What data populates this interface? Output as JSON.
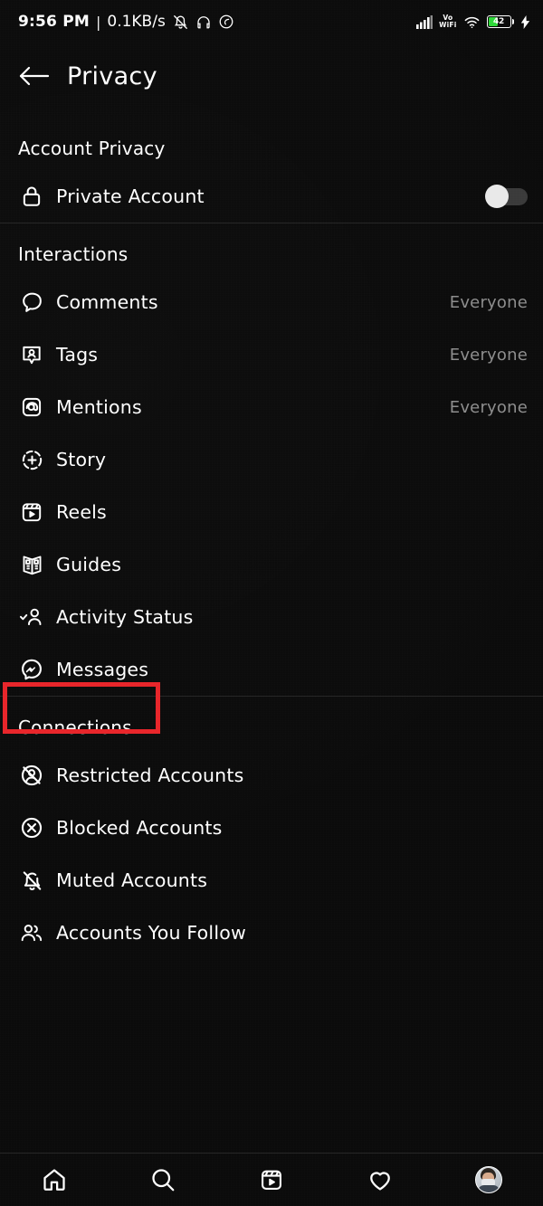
{
  "status_bar": {
    "time": "9:56 PM",
    "separator": "|",
    "network_speed": "0.1KB/s",
    "left_icons": [
      "mute-bell-icon",
      "headphones-icon",
      "dnd-icon"
    ],
    "vowifi_top": "Vo",
    "vowifi_bottom": "WiFi",
    "battery_level": "42",
    "right_icons": [
      "signal-bars-icon",
      "vowifi-icon",
      "wifi-icon",
      "battery-icon",
      "charging-bolt-icon"
    ]
  },
  "header": {
    "back_icon": "arrow-left-icon",
    "title": "Privacy"
  },
  "sections": [
    {
      "id": "account-privacy",
      "title": "Account Privacy",
      "rows": [
        {
          "id": "private-account",
          "icon": "lock-icon",
          "label": "Private Account",
          "control": "toggle",
          "toggle_on": false
        }
      ]
    },
    {
      "id": "interactions",
      "title": "Interactions",
      "rows": [
        {
          "id": "comments",
          "icon": "comment-bubble-icon",
          "label": "Comments",
          "value": "Everyone"
        },
        {
          "id": "tags",
          "icon": "tag-person-icon",
          "label": "Tags",
          "value": "Everyone"
        },
        {
          "id": "mentions",
          "icon": "at-sign-icon",
          "label": "Mentions",
          "value": "Everyone"
        },
        {
          "id": "story",
          "icon": "story-plus-icon",
          "label": "Story",
          "value": ""
        },
        {
          "id": "reels",
          "icon": "reels-icon",
          "label": "Reels",
          "value": ""
        },
        {
          "id": "guides",
          "icon": "guides-book-icon",
          "label": "Guides",
          "value": ""
        },
        {
          "id": "activity-status",
          "icon": "activity-status-icon",
          "label": "Activity Status",
          "value": ""
        },
        {
          "id": "messages",
          "icon": "messenger-icon",
          "label": "Messages",
          "value": "",
          "highlighted": true
        }
      ]
    },
    {
      "id": "connections",
      "title": "Connections",
      "rows": [
        {
          "id": "restricted-accounts",
          "icon": "restricted-person-icon",
          "label": "Restricted Accounts",
          "value": ""
        },
        {
          "id": "blocked-accounts",
          "icon": "blocked-circle-x-icon",
          "label": "Blocked Accounts",
          "value": ""
        },
        {
          "id": "muted-accounts",
          "icon": "muted-bell-icon",
          "label": "Muted Accounts",
          "value": ""
        },
        {
          "id": "accounts-you-follow",
          "icon": "people-group-icon",
          "label": "Accounts You Follow",
          "value": ""
        }
      ]
    }
  ],
  "highlight": {
    "color": "#e8252a",
    "target": "Messages"
  },
  "bottom_nav": [
    {
      "id": "home",
      "icon": "home-icon"
    },
    {
      "id": "search",
      "icon": "search-icon"
    },
    {
      "id": "reels",
      "icon": "reels-icon"
    },
    {
      "id": "activity",
      "icon": "heart-icon"
    },
    {
      "id": "profile",
      "icon": "profile-avatar"
    }
  ],
  "colors": {
    "background": "#0b0b0b",
    "text_primary": "#ffffff",
    "text_secondary": "#8d8d8d",
    "divider": "#262626",
    "highlight_red": "#e8252a",
    "battery_green": "#2fd93a"
  }
}
